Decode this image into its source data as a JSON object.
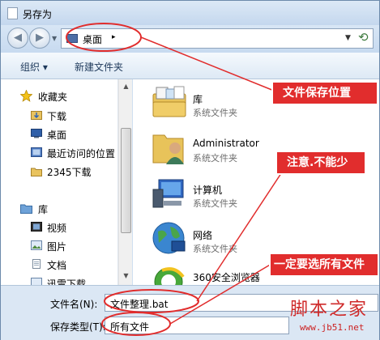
{
  "window": {
    "title": "另存为"
  },
  "nav": {
    "address": "桌面",
    "address_arrow": "▸"
  },
  "toolbar": {
    "organize": "组织 ▾",
    "new_folder": "新建文件夹"
  },
  "sidebar": {
    "favorites": "收藏夹",
    "items": [
      "下载",
      "桌面",
      "最近访问的位置",
      "2345下载"
    ],
    "library": "库",
    "library_items": [
      "视频",
      "图片",
      "文档",
      "迅雷下载"
    ]
  },
  "files": [
    {
      "name": "库",
      "type": "系统文件夹",
      "icon": "library-icon"
    },
    {
      "name": "Administrator",
      "type": "系统文件夹",
      "icon": "user-icon"
    },
    {
      "name": "计算机",
      "type": "系统文件夹",
      "icon": "computer-icon"
    },
    {
      "name": "网络",
      "type": "系统文件夹",
      "icon": "network-icon"
    },
    {
      "name": "360安全浏览器",
      "type": "",
      "icon": "browser-icon"
    }
  ],
  "bottom": {
    "filename_label": "文件名(N):",
    "filename_value": "文件整理.bat",
    "filetype_label": "保存类型(T):",
    "filetype_value": "所有文件"
  },
  "callouts": {
    "location": "文件保存位置",
    "attention": "注意.不能少",
    "select_all": "一定要选所有文件"
  },
  "watermark": {
    "text": "脚本之家",
    "url": "www.jb51.net"
  },
  "colors": {
    "annotation_red": "#e12d2d",
    "window_frame": "#cfdff0"
  }
}
